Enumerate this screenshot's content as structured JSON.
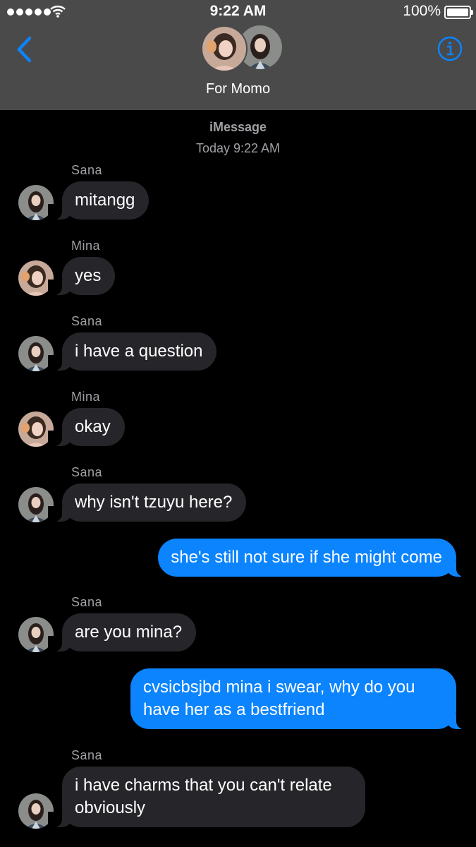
{
  "status_bar": {
    "time": "9:22 AM",
    "battery": "100%"
  },
  "header": {
    "title": "For Momo",
    "back_icon": "chevron-left-icon",
    "info_icon": "info-circle-icon"
  },
  "meta": {
    "service": "iMessage",
    "timestamp": "Today 9:22 AM"
  },
  "colors": {
    "header_bg": "#4a4a4a",
    "incoming_bubble": "#26252a",
    "outgoing_bubble": "#0b84fe",
    "accent": "#0b84fe",
    "meta_text": "#a0a0a5"
  },
  "messages": [
    {
      "sender": "Sana",
      "text": "mitangg"
    },
    {
      "sender": "Mina",
      "text": "yes"
    },
    {
      "sender": "Sana",
      "text": "i have a question"
    },
    {
      "sender": "Mina",
      "text": "okay"
    },
    {
      "sender": "Sana",
      "text": "why isn't tzuyu here?"
    },
    {
      "sender": "",
      "text": "she's still not sure if she might come"
    },
    {
      "sender": "Sana",
      "text": "are you mina?"
    },
    {
      "sender": "",
      "text": "cvsicbsjbd mina i swear, why do you have her as a bestfriend"
    },
    {
      "sender": "Sana",
      "text": "i have charms that you can't relate obviously"
    }
  ]
}
